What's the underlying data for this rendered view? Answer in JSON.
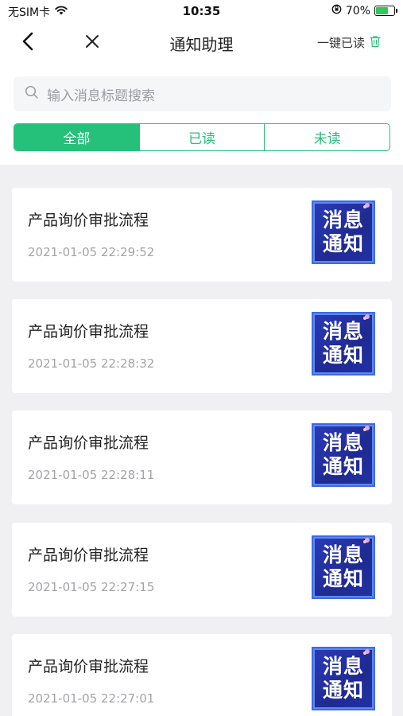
{
  "status_bar": {
    "carrier": "无SIM卡",
    "time": "10:35",
    "battery": "70%",
    "battery_level": 0.7
  },
  "nav": {
    "title": "通知助理",
    "mark_all_read": "一键已读"
  },
  "search": {
    "placeholder": "输入消息标题搜索"
  },
  "tabs": [
    {
      "label": "全部",
      "active": true
    },
    {
      "label": "已读",
      "active": false
    },
    {
      "label": "未读",
      "active": false
    }
  ],
  "messages": [
    {
      "title": "产品询价审批流程",
      "time": "2021-01-05 22:29:52",
      "thumb_line1": "消息",
      "thumb_line2": "通知"
    },
    {
      "title": "产品询价审批流程",
      "time": "2021-01-05 22:28:32",
      "thumb_line1": "消息",
      "thumb_line2": "通知"
    },
    {
      "title": "产品询价审批流程",
      "time": "2021-01-05 22:28:11",
      "thumb_line1": "消息",
      "thumb_line2": "通知"
    },
    {
      "title": "产品询价审批流程",
      "time": "2021-01-05 22:27:15",
      "thumb_line1": "消息",
      "thumb_line2": "通知"
    },
    {
      "title": "产品询价审批流程",
      "time": "2021-01-05 22:27:01",
      "thumb_line1": "消息",
      "thumb_line2": "通知"
    }
  ],
  "colors": {
    "accent": "#25c17a",
    "list_background": "#f0f0f2"
  }
}
